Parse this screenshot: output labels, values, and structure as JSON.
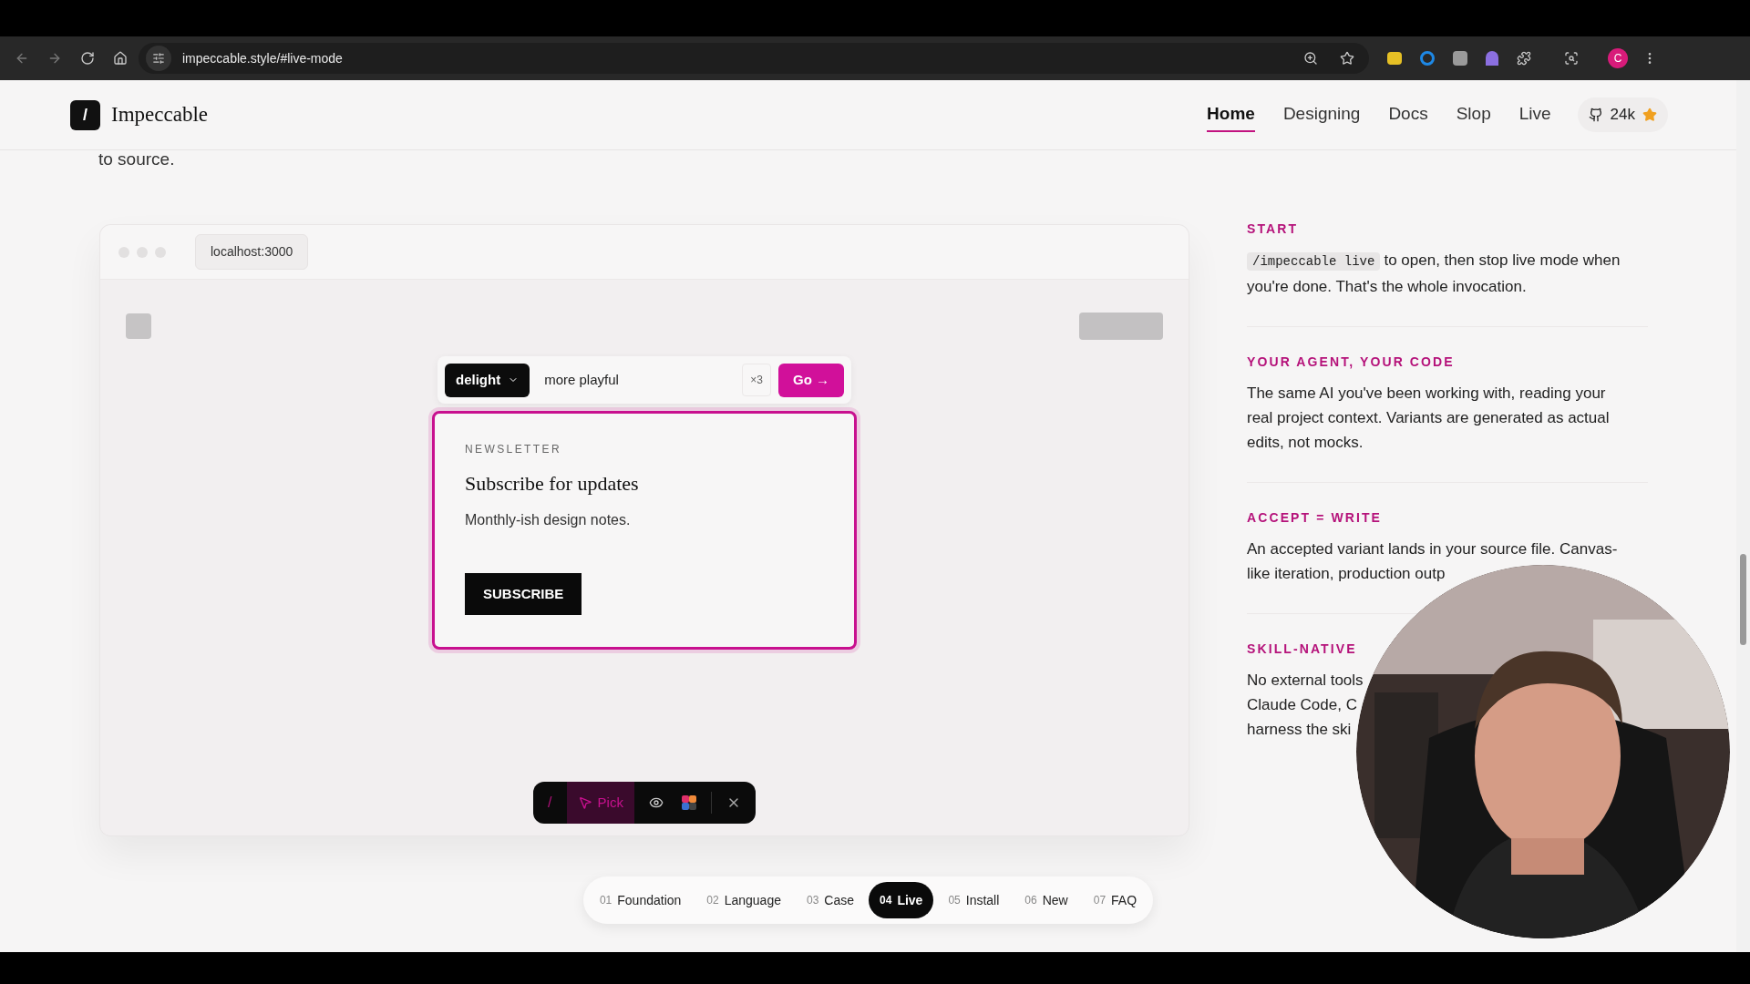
{
  "browser": {
    "url": "impeccable.style/#live-mode",
    "avatar": "C"
  },
  "header": {
    "logo_mark": "/",
    "brand": "Impeccable",
    "nav": [
      {
        "label": "Home",
        "selected": true
      },
      {
        "label": "Designing",
        "selected": false
      },
      {
        "label": "Docs",
        "selected": false
      },
      {
        "label": "Slop",
        "selected": false
      },
      {
        "label": "Live",
        "selected": false
      }
    ],
    "stars": "24k"
  },
  "intro_tail": "to source.",
  "mockup": {
    "address": "localhost:3000",
    "prompt": {
      "mode": "delight",
      "value": "more playful",
      "count": "×3",
      "go": "Go →"
    },
    "card": {
      "eyebrow": "NEWSLETTER",
      "title": "Subscribe for updates",
      "body": "Monthly-ish design notes.",
      "button": "SUBSCRIBE"
    },
    "toolbar": {
      "mark": "/",
      "pick": "Pick",
      "pick_selected": true
    }
  },
  "features": [
    {
      "heading": "START",
      "code": "/impeccable live",
      "lines": [
        "to open, then stop live mode when you're done. That's the whole invocation."
      ]
    },
    {
      "heading": "YOUR AGENT, YOUR CODE",
      "lines": [
        "The same AI you've been working with, reading your",
        "real project context. Variants are generated as actual",
        "edits, not mocks."
      ]
    },
    {
      "heading": "ACCEPT = WRITE",
      "lines": [
        "An accepted variant lands in your source file. Canvas-",
        "like iteration, production outp"
      ]
    },
    {
      "heading": "SKILL-NATIVE",
      "lines": [
        "No external tools",
        "Claude Code, C",
        "harness the ski"
      ]
    }
  ],
  "sections": [
    {
      "number": "01",
      "label": "Foundation",
      "selected": false
    },
    {
      "number": "02",
      "label": "Language",
      "selected": false
    },
    {
      "number": "03",
      "label": "Case",
      "selected": false
    },
    {
      "number": "04",
      "label": "Live",
      "selected": true
    },
    {
      "number": "05",
      "label": "Install",
      "selected": false
    },
    {
      "number": "06",
      "label": "New",
      "selected": false
    },
    {
      "number": "07",
      "label": "FAQ",
      "selected": false
    }
  ]
}
